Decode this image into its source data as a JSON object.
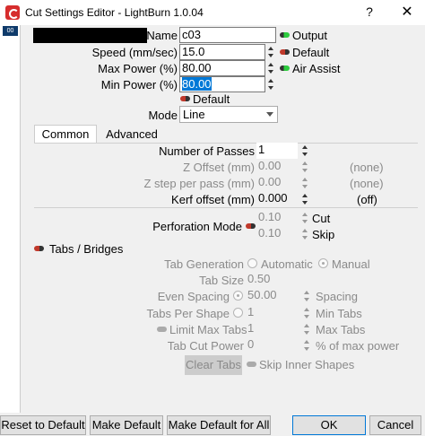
{
  "window": {
    "title": "Cut Settings Editor - LightBurn 1.0.04",
    "help_label": "?",
    "close_label": "✕"
  },
  "layer": {
    "chip": "00"
  },
  "fields": {
    "name_label": "Name",
    "name_value": "c03",
    "speed_label": "Speed (mm/sec)",
    "speed_value": "15.0",
    "max_power_label": "Max Power (%)",
    "max_power_value": "80.00",
    "min_power_label": "Min Power (%)",
    "min_power_value": "80.00",
    "default_toggle_label": "Default",
    "mode_label": "Mode",
    "mode_value": "Line"
  },
  "toggles": {
    "output": "Output",
    "default": "Default",
    "air_assist": "Air Assist"
  },
  "tabs": [
    {
      "label": "Common"
    },
    {
      "label": "Advanced"
    }
  ],
  "common": {
    "passes_label": "Number of Passes",
    "passes_value": "1",
    "z_offset_label": "Z Offset (mm)",
    "z_offset_value": "0.00",
    "z_offset_note": "(none)",
    "z_step_label": "Z step per pass (mm)",
    "z_step_value": "0.00",
    "z_step_note": "(none)",
    "kerf_label": "Kerf offset (mm)",
    "kerf_value": "0.000",
    "kerf_note": "(off)",
    "perf_label": "Perforation Mode",
    "perf_cut_value": "0.10",
    "perf_cut_label": "Cut",
    "perf_skip_value": "0.10",
    "perf_skip_label": "Skip"
  },
  "tabs_bridges": {
    "header": "Tabs / Bridges",
    "generation_label": "Tab Generation",
    "automatic": "Automatic",
    "manual": "Manual",
    "tab_size_label": "Tab Size",
    "tab_size_value": "0.50",
    "even_spacing_label": "Even Spacing",
    "spacing_value": "50.00",
    "spacing_label": "Spacing",
    "tabs_per_shape_label": "Tabs Per Shape",
    "min_tabs_value": "1",
    "min_tabs_label": "Min Tabs",
    "limit_max_label": "Limit Max Tabs",
    "max_tabs_value": "1",
    "max_tabs_label": "Max Tabs",
    "cut_power_label": "Tab Cut Power",
    "cut_power_value": "0",
    "cut_power_unit": "% of max power",
    "clear_tabs": "Clear Tabs",
    "skip_inner": "Skip Inner Shapes"
  },
  "buttons": {
    "reset": "Reset to Default",
    "make_default": "Make Default",
    "make_default_all": "Make Default for All",
    "ok": "OK",
    "cancel": "Cancel"
  }
}
